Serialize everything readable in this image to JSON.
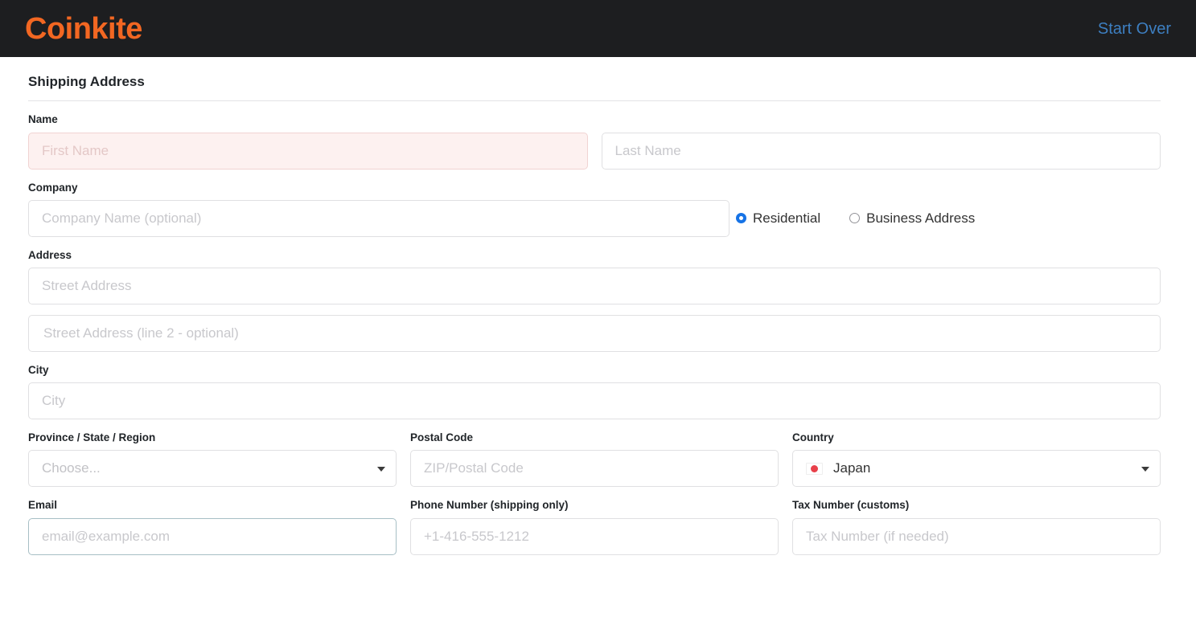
{
  "header": {
    "brand": "Coinkite",
    "start_over_label": "Start Over",
    "brand_color": "#f26722",
    "link_color": "#3d7fc1",
    "background": "#1d1e20"
  },
  "form": {
    "section_title": "Shipping Address",
    "name": {
      "label": "Name",
      "first": {
        "placeholder": "First Name",
        "value": "",
        "invalid": true
      },
      "last": {
        "placeholder": "Last Name",
        "value": ""
      }
    },
    "company": {
      "label": "Company",
      "placeholder": "Company Name (optional)",
      "value": "",
      "address_type": {
        "residential_label": "Residential",
        "business_label": "Business Address",
        "selected": "Residential"
      }
    },
    "address": {
      "label": "Address",
      "line1_placeholder": "Street Address",
      "line1_value": "",
      "line2_placeholder": "Street Address (line 2 - optional)",
      "line2_value": ""
    },
    "city": {
      "label": "City",
      "placeholder": "City",
      "value": ""
    },
    "province": {
      "label": "Province / State / Region",
      "placeholder": "Choose...",
      "value": ""
    },
    "postal": {
      "label": "Postal Code",
      "placeholder": "ZIP/Postal Code",
      "value": ""
    },
    "country": {
      "label": "Country",
      "value": "Japan",
      "flag": "jp-flag-icon"
    },
    "email": {
      "label": "Email",
      "placeholder": "email@example.com",
      "value": ""
    },
    "phone": {
      "label": "Phone Number (shipping only)",
      "placeholder": "+1-416-555-1212",
      "value": ""
    },
    "tax": {
      "label": "Tax Number (customs)",
      "placeholder": "Tax Number (if needed)",
      "value": ""
    }
  },
  "colors": {
    "invalid_bg": "#fdf1f0",
    "invalid_border": "#f0d3d2",
    "email_border": "#a7bfc5",
    "radio_checked": "#1673e6"
  }
}
